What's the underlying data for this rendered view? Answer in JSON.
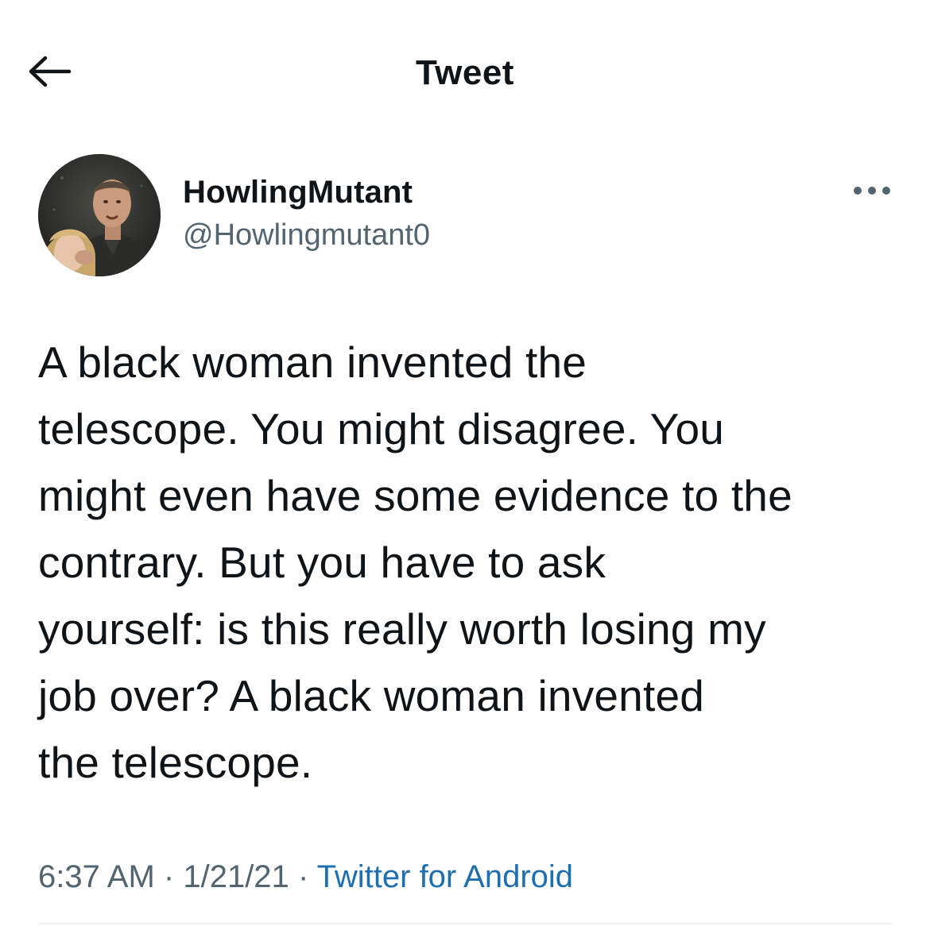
{
  "header": {
    "title": "Tweet",
    "back_icon": "arrow-left-icon"
  },
  "tweet": {
    "author": {
      "display_name": "HowlingMutant",
      "handle": "@Howlingmutant0",
      "avatar": "profile-photo"
    },
    "more_icon": "more-horizontal-icon",
    "text": "A black woman invented the\ntelescope.  You might disagree.  You\nmight even have some evidence to the\ncontrary.  But you have to ask\nyourself: is this really worth losing my\njob over?  A black woman invented\nthe telescope.",
    "time": "6:37 AM",
    "separator": "·",
    "date": "1/21/21",
    "source": "Twitter for Android"
  },
  "colors": {
    "text_primary": "#0f1419",
    "text_secondary": "#536471",
    "link": "#1d6fb0",
    "divider": "#eff3f4"
  }
}
